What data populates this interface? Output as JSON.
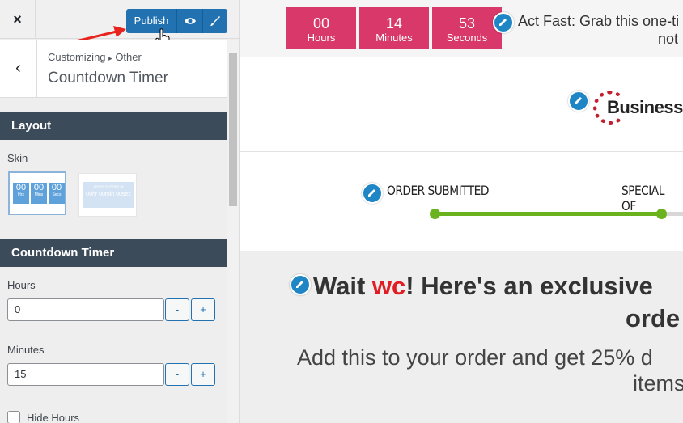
{
  "topbar": {
    "close_icon": "×",
    "publish_label": "Publish",
    "preview_icon": "eye-icon",
    "customize_icon": "brush-icon"
  },
  "section": {
    "breadcrumb_root": "Customizing",
    "breadcrumb_sep": "▸",
    "breadcrumb_parent": "Other",
    "title": "Countdown Timer",
    "back_icon": "‹"
  },
  "layout_group": {
    "title": "Layout",
    "skin_label": "Skin",
    "skins": [
      {
        "boxes": [
          {
            "num": "00",
            "unit": "Hrs"
          },
          {
            "num": "00",
            "unit": "Mins"
          },
          {
            "num": "00",
            "unit": "Secs"
          }
        ],
        "selected": true
      },
      {
        "caption": "OFFER EXPIRES IN",
        "text": "00hr 00min 00sec",
        "selected": false
      }
    ]
  },
  "countdown_group": {
    "title": "Countdown Timer",
    "hours_label": "Hours",
    "hours_value": "0",
    "minutes_label": "Minutes",
    "minutes_value": "15",
    "minus": "-",
    "plus": "+",
    "hide_hours_label": "Hide Hours"
  },
  "preview": {
    "timer": [
      {
        "num": "00",
        "unit": "Hours"
      },
      {
        "num": "14",
        "unit": "Minutes"
      },
      {
        "num": "53",
        "unit": "Seconds"
      }
    ],
    "act_fast_line1": "Act Fast: Grab this one-ti",
    "act_fast_line2": "not",
    "logo_text": "Business",
    "steps": [
      "ORDER SUBMITTED",
      "SPECIAL OF"
    ],
    "headline_pre": "Wait ",
    "headline_name": "wc",
    "headline_post": "! Here's an exclusive",
    "headline_line2": "orde",
    "sub_line1": "Add this to your order and get 25% d",
    "sub_line2": "items"
  },
  "colors": {
    "accent_blue": "#2271b1",
    "timer_pink": "#d8386a",
    "progress_green": "#6ab31f",
    "panel_dark": "#3c4b5a",
    "highlight_red": "#e21c23"
  }
}
